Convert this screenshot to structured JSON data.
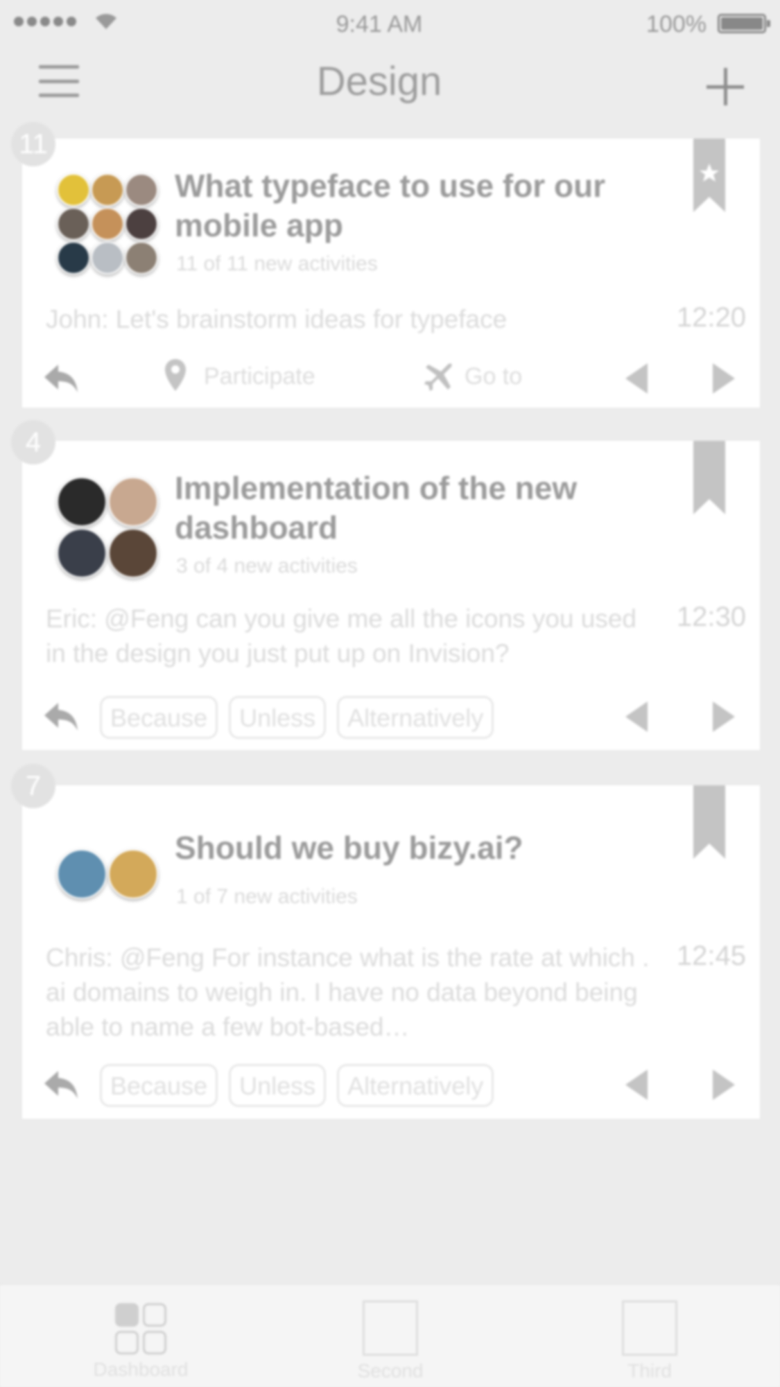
{
  "status_bar": {
    "time": "9:41 AM",
    "battery": "100%"
  },
  "nav": {
    "title": "Design"
  },
  "cards": [
    {
      "count": "11",
      "title": "What typeface to use for our mobile app",
      "subtitle": "11 of 11 new activities",
      "message": "John: Let's brainstorm ideas for typeface",
      "time": "12:20",
      "actions": {
        "participate": "Participate",
        "goto": "Go to"
      },
      "avatar_colors": [
        "#e2c13a",
        "#c79a54",
        "#9b8a80",
        "#6a6058",
        "#c5915a",
        "#4c4040",
        "#283a48",
        "#b9bec4",
        "#8c8074"
      ]
    },
    {
      "count": "4",
      "title": "Implementation of the new dashboard",
      "subtitle": "3 of 4 new activities",
      "message": "Eric: @Feng can you give me all the icons you used in the design you just put up on Invision?",
      "time": "12:30",
      "tags": [
        "Because",
        "Unless",
        "Alternatively"
      ],
      "avatar_colors": [
        "#2a2a2a",
        "#c8a890",
        "#3a3f4a",
        "#5a4638"
      ]
    },
    {
      "count": "7",
      "title": "Should we buy bizy.ai?",
      "subtitle": "1 of 7 new activities",
      "message": "Chris: @Feng For instance what is the rate at which . ai domains to weigh in. I have no data beyond being able to name a few bot-based…",
      "time": "12:45",
      "tags": [
        "Because",
        "Unless",
        "Alternatively"
      ],
      "avatar_colors": [
        "#5f8fb0",
        "#d3a95a"
      ]
    }
  ],
  "tabbar": {
    "tabs": [
      "Dashboard",
      "Second",
      "Third"
    ]
  }
}
